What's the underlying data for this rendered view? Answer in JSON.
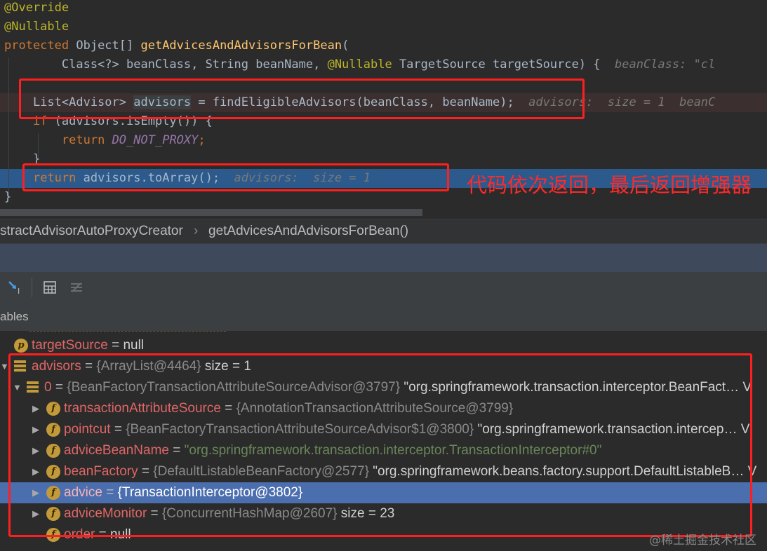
{
  "editor": {
    "lines": [
      {
        "parts": [
          {
            "t": "@Override",
            "c": "anno"
          }
        ]
      },
      {
        "parts": [
          {
            "t": "@Nullable",
            "c": "anno"
          }
        ]
      },
      {
        "parts": [
          {
            "t": "protected",
            "c": "kw"
          },
          {
            "t": " Object[] ",
            "c": ""
          },
          {
            "t": "getAdvicesAndAdvisorsForBean",
            "c": "fn"
          },
          {
            "t": "(",
            "c": ""
          }
        ]
      },
      {
        "parts": [
          {
            "t": "        Class<?> beanClass, String beanName, ",
            "c": ""
          },
          {
            "t": "@Nullable",
            "c": "anno"
          },
          {
            "t": " TargetSource targetSource) {  ",
            "c": ""
          },
          {
            "t": "beanClass: \"cl",
            "c": "hint"
          }
        ]
      },
      {
        "parts": [
          {
            "t": "",
            "c": ""
          }
        ]
      },
      {
        "parts": [
          {
            "t": "    List<Advisor> ",
            "c": ""
          },
          {
            "t": "advisors",
            "c": "hl-var"
          },
          {
            "t": " = findEligibleAdvisors(beanClass, beanName);  ",
            "c": ""
          },
          {
            "t": "advisors:  size = 1  beanC",
            "c": "hint"
          }
        ]
      },
      {
        "parts": [
          {
            "t": "    ",
            "c": ""
          },
          {
            "t": "if",
            "c": "kw"
          },
          {
            "t": " (advisors.isEmpty()) {",
            "c": ""
          }
        ]
      },
      {
        "parts": [
          {
            "t": "        ",
            "c": ""
          },
          {
            "t": "return",
            "c": "kw"
          },
          {
            "t": " ",
            "c": ""
          },
          {
            "t": "DO_NOT_PROXY",
            "c": "const"
          },
          {
            "t": ";",
            "c": "kw"
          }
        ]
      },
      {
        "parts": [
          {
            "t": "    }",
            "c": ""
          }
        ]
      },
      {
        "parts": [
          {
            "t": "    ",
            "c": ""
          },
          {
            "t": "return",
            "c": "kw"
          },
          {
            "t": " advisors.toArray();  ",
            "c": ""
          },
          {
            "t": "advisors:  size = 1",
            "c": "hint"
          }
        ]
      },
      {
        "parts": [
          {
            "t": "}",
            "c": ""
          }
        ]
      }
    ]
  },
  "annotation_note": "代码依次返回，最后返回增强器",
  "breadcrumb": {
    "class_name": "stractAdvisorAutoProxyCreator",
    "separator": "›",
    "method_name": "getAdvicesAndAdvisorsForBean()"
  },
  "variables_header": {
    "title": "ables"
  },
  "tree": [
    {
      "indent": 0,
      "expand": "",
      "icon": "p",
      "name": "targetSource",
      "rest": [
        {
          "t": " = ",
          "c": "eq"
        },
        {
          "t": "null",
          "c": "white"
        }
      ]
    },
    {
      "indent": 0,
      "expand": "▼",
      "icon": "list",
      "name": "advisors",
      "rest": [
        {
          "t": " = ",
          "c": "eq"
        },
        {
          "t": "{ArrayList@4464}",
          "c": "gray"
        },
        {
          "t": "  size = 1",
          "c": "white"
        }
      ]
    },
    {
      "indent": 1,
      "expand": "▼",
      "icon": "list",
      "name": "0",
      "rest": [
        {
          "t": " = ",
          "c": "eq"
        },
        {
          "t": "{BeanFactoryTransactionAttributeSourceAdvisor@3797}",
          "c": "gray"
        },
        {
          "t": " \"org.springframework.transaction.interceptor.BeanFact… V",
          "c": "white"
        }
      ]
    },
    {
      "indent": 2,
      "expand": "▶",
      "icon": "f",
      "name": "transactionAttributeSource",
      "rest": [
        {
          "t": " = ",
          "c": "eq"
        },
        {
          "t": "{AnnotationTransactionAttributeSource@3799}",
          "c": "gray"
        }
      ]
    },
    {
      "indent": 2,
      "expand": "▶",
      "icon": "f",
      "name": "pointcut",
      "rest": [
        {
          "t": " = ",
          "c": "eq"
        },
        {
          "t": "{BeanFactoryTransactionAttributeSourceAdvisor$1@3800}",
          "c": "gray"
        },
        {
          "t": " \"org.springframework.transaction.intercep… V",
          "c": "white"
        }
      ]
    },
    {
      "indent": 2,
      "expand": "▶",
      "icon": "f",
      "name": "adviceBeanName",
      "rest": [
        {
          "t": " = ",
          "c": "eq"
        },
        {
          "t": "\"org.springframework.transaction.interceptor.TransactionInterceptor#0\"",
          "c": "str"
        }
      ]
    },
    {
      "indent": 2,
      "expand": "▶",
      "icon": "f",
      "name": "beanFactory",
      "rest": [
        {
          "t": " = ",
          "c": "eq"
        },
        {
          "t": "{DefaultListableBeanFactory@2577}",
          "c": "gray"
        },
        {
          "t": " \"org.springframework.beans.factory.support.DefaultListableB… V",
          "c": "white"
        }
      ]
    },
    {
      "indent": 2,
      "expand": "▶",
      "icon": "f",
      "name": "advice",
      "selected": true,
      "rest": [
        {
          "t": " = ",
          "c": "eq"
        },
        {
          "t": "{TransactionInterceptor@3802}",
          "c": "white"
        }
      ]
    },
    {
      "indent": 2,
      "expand": "▶",
      "icon": "f",
      "name": "adviceMonitor",
      "rest": [
        {
          "t": " = ",
          "c": "eq"
        },
        {
          "t": "{ConcurrentHashMap@2607}",
          "c": "gray"
        },
        {
          "t": "  size = 23",
          "c": "white"
        }
      ]
    },
    {
      "indent": 2,
      "expand": "",
      "icon": "f",
      "name": "order",
      "rest": [
        {
          "t": " = ",
          "c": "eq"
        },
        {
          "t": "null",
          "c": "white"
        }
      ]
    }
  ],
  "watermark": "@稀土掘金技术社区",
  "colors": {
    "annotation_red": "#ff1f1f",
    "exec_line": "#2d5a8c",
    "selection": "#4b6eaf"
  }
}
